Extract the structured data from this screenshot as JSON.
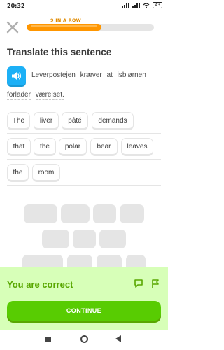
{
  "status_bar": {
    "time": "20:32",
    "battery": "43"
  },
  "header": {
    "streak_label": "9 IN A ROW",
    "progress_fraction": 0.59
  },
  "title": "Translate this sentence",
  "prompt": {
    "line1": [
      "Leverpostejen",
      "kræver",
      "at",
      "isbjørnen"
    ],
    "line2": [
      "forlader",
      "værelset."
    ]
  },
  "answer_tiles": [
    "The",
    "liver",
    "pâté",
    "demands",
    "that",
    "the",
    "polar",
    "bear",
    "leaves",
    "the",
    "room"
  ],
  "feedback": {
    "message": "You are correct",
    "continue_label": "CONTINUE",
    "colors": {
      "panel": "#d7ffb8",
      "text": "#58a700",
      "button": "#58cc02"
    }
  },
  "icons": [
    "close-icon",
    "speaker-icon",
    "comment-icon",
    "flag-icon",
    "nav-recents-icon",
    "nav-home-icon",
    "nav-back-icon"
  ]
}
